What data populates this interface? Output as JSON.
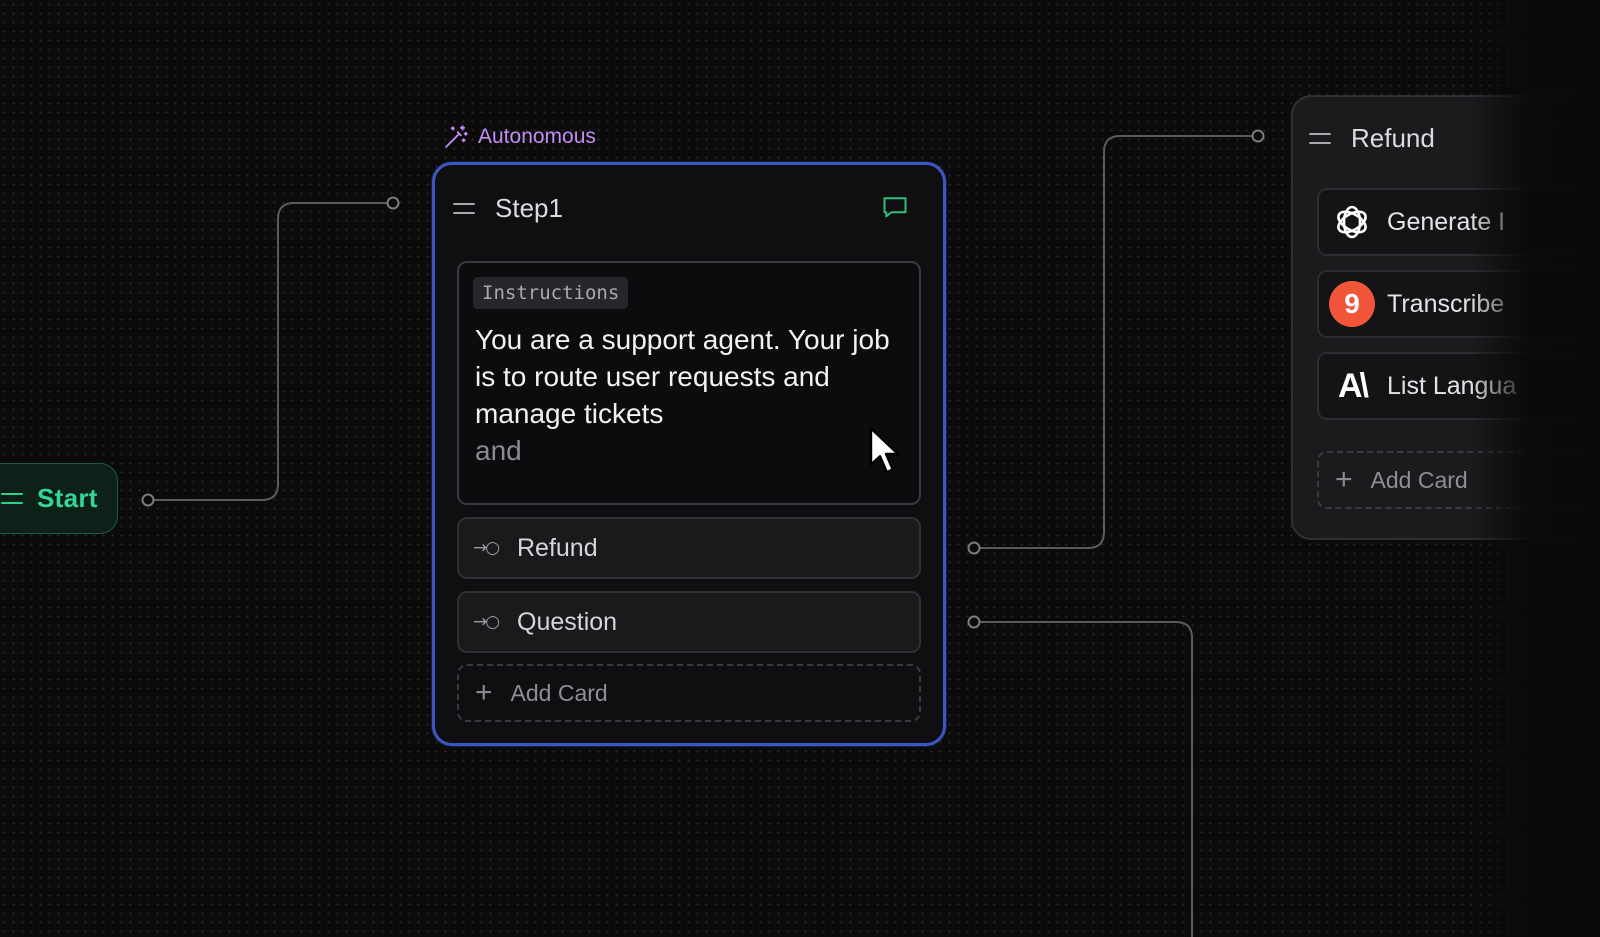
{
  "start_node": {
    "label": "Start"
  },
  "step_node": {
    "mode_label": "Autonomous",
    "title": "Step1",
    "instructions": {
      "tag": "Instructions",
      "text": "You are a support agent. Your job is to route user requests and manage tickets",
      "text_faded": "and"
    },
    "routes": [
      {
        "label": "Refund"
      },
      {
        "label": "Question"
      }
    ],
    "add_card_label": "Add Card"
  },
  "refund_node": {
    "title": "Refund",
    "tools": [
      {
        "label": "Generate I",
        "icon": "openai-icon"
      },
      {
        "label": "Transcribe",
        "icon": "gladia-icon"
      },
      {
        "label": "List Langua",
        "icon": "anthropic-icon"
      }
    ],
    "add_card_label": "Add Card"
  },
  "colors": {
    "canvas_bg": "#0b0b0c",
    "start_accent": "#34d399",
    "selected_border": "#3a57c4",
    "autonomous_accent": "#c58cf5",
    "chat_icon": "#2fbf7a",
    "gladia_red": "#f1563a"
  }
}
